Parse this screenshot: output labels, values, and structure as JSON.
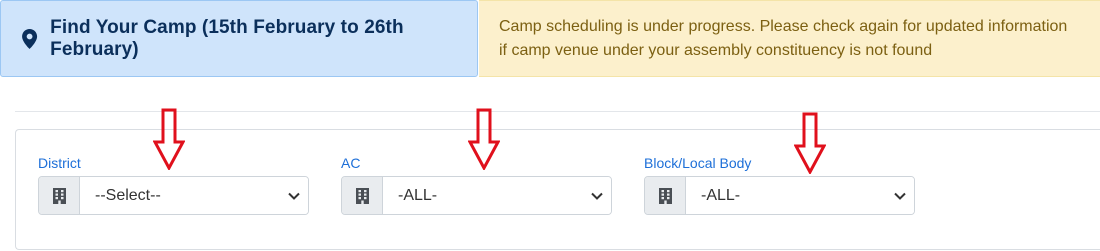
{
  "header": {
    "find_title": "Find Your Camp (15th February to 26th February)",
    "find_icon": "map-marker-icon",
    "notice_line1": "Camp scheduling is under progress. Please check again for updated information",
    "notice_line2": "if camp venue under your assembly constituency is not found"
  },
  "filters": [
    {
      "label": "District",
      "value": "--Select--",
      "icon": "building-icon"
    },
    {
      "label": "AC",
      "value": "-ALL-",
      "icon": "building-icon"
    },
    {
      "label": "Block/Local Body",
      "value": "-ALL-",
      "icon": "building-icon"
    }
  ],
  "colors": {
    "accent_blue": "#1d6fd8",
    "title_navy": "#0b2f5b",
    "notice_text": "#7c6012",
    "arrow_red": "#e0101c"
  }
}
